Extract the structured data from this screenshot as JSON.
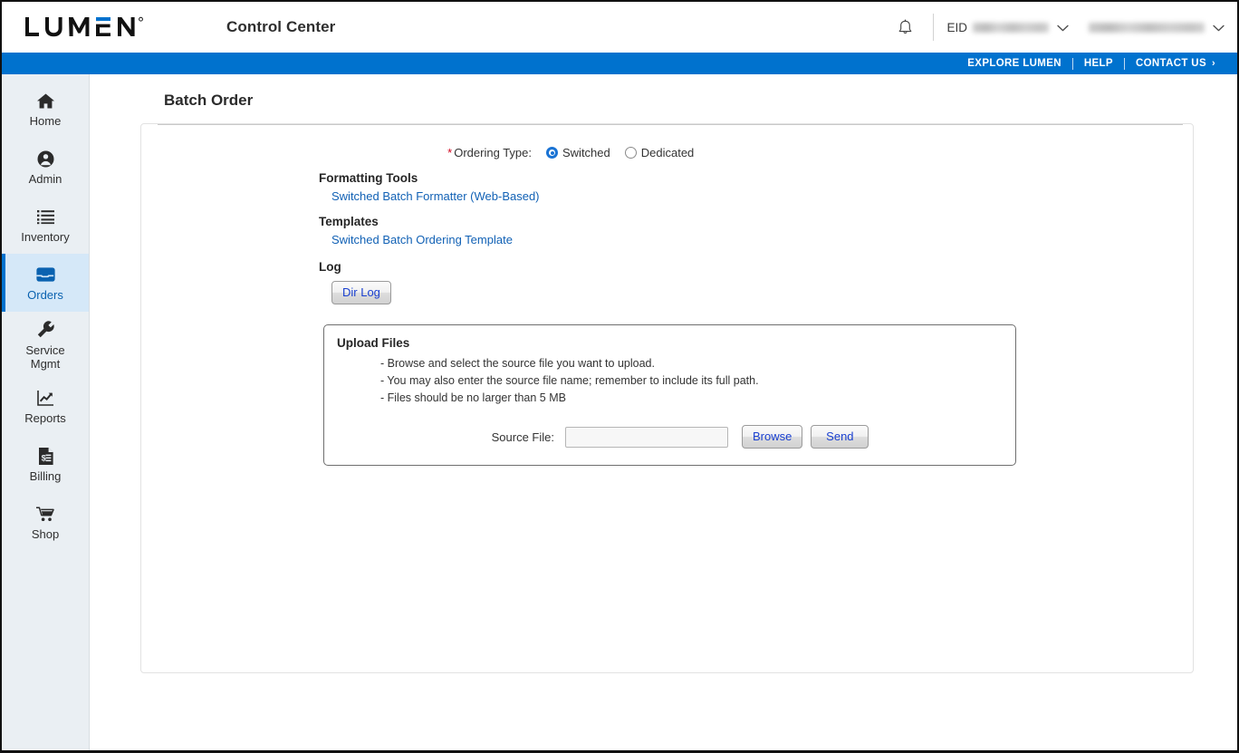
{
  "header": {
    "logo_text": "LUMEN",
    "logo_name": "lumen-logo",
    "app_title": "Control Center",
    "notifications_icon": "bell-icon",
    "eid_label": "EID",
    "eid_value": "",
    "user_value": "",
    "chevron_icon": "chevron-down-icon"
  },
  "utility_nav": {
    "items": [
      {
        "label": "EXPLORE LUMEN",
        "name": "explore-lumen-link"
      },
      {
        "label": "HELP",
        "name": "help-link"
      },
      {
        "label": "CONTACT US",
        "name": "contact-us-link",
        "caret": "›"
      }
    ]
  },
  "sidebar": {
    "items": [
      {
        "label": "Home",
        "icon": "home-icon",
        "active": false
      },
      {
        "label": "Admin",
        "icon": "user-circle-icon",
        "active": false
      },
      {
        "label": "Inventory",
        "icon": "list-icon",
        "active": false
      },
      {
        "label": "Orders",
        "icon": "inbox-tray-icon",
        "active": true
      },
      {
        "label": "Service Mgmt",
        "label_line1": "Service",
        "label_line2": "Mgmt",
        "icon": "wrench-icon",
        "active": false
      },
      {
        "label": "Reports",
        "icon": "chart-trend-icon",
        "active": false
      },
      {
        "label": "Billing",
        "icon": "invoice-dollar-icon",
        "active": false
      },
      {
        "label": "Shop",
        "icon": "shopping-cart-icon",
        "active": false
      }
    ]
  },
  "main": {
    "page_title": "Batch Order",
    "ordering_type": {
      "required_marker": "*",
      "label": "Ordering Type:",
      "options": [
        {
          "label": "Switched",
          "selected": true
        },
        {
          "label": "Dedicated",
          "selected": false
        }
      ]
    },
    "formatting_tools": {
      "heading": "Formatting Tools",
      "link": "Switched Batch Formatter (Web-Based)"
    },
    "templates": {
      "heading": "Templates",
      "link": "Switched Batch Ordering Template"
    },
    "log": {
      "heading": "Log",
      "button": "Dir Log"
    },
    "upload": {
      "title": "Upload Files",
      "instructions": [
        "- Browse and select the source file you want to upload.",
        "- You may also enter the source file name; remember to include its full path.",
        "- Files should be no larger than 5 MB"
      ],
      "source_file_label": "Source File:",
      "source_file_value": "",
      "source_file_placeholder": "",
      "browse_button": "Browse",
      "send_button": "Send"
    }
  },
  "colors": {
    "brand_blue": "#0072ce",
    "link_blue": "#1161b5",
    "active_nav_bg": "#d5e8f8",
    "required_red": "#d0021b",
    "button_text_blue": "#1a40d0"
  }
}
